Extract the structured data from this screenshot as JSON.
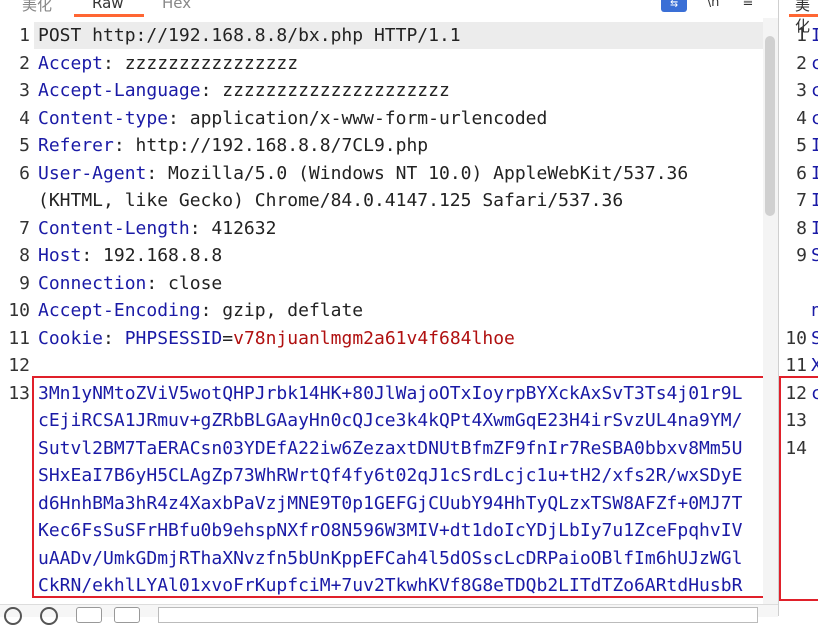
{
  "tabs": [
    {
      "label": "美化",
      "active": false
    },
    {
      "label": "Raw",
      "active": true
    },
    {
      "label": "Hex",
      "active": false
    }
  ],
  "toolbar": {
    "icon1": "\\n",
    "icon2": "≡",
    "wrap_icon": "wrap-icon"
  },
  "right_tab": {
    "label": "美化"
  },
  "request_lines": [
    {
      "num": "1",
      "text": "POST http://192.168.8.8/bx.php HTTP/1.1"
    },
    {
      "num": "2",
      "key": "Accept",
      "val": " zzzzzzzzzzzzzzzz"
    },
    {
      "num": "3",
      "key": "Accept-Language",
      "val": " zzzzzzzzzzzzzzzzzzzzz"
    },
    {
      "num": "4",
      "key": "Content-type",
      "val": " application/x-www-form-urlencoded"
    },
    {
      "num": "5",
      "key": "Referer",
      "val": " http://192.168.8.8/7CL9.php"
    },
    {
      "num": "6",
      "key": "User-Agent",
      "val": " Mozilla/5.0 (Windows NT 10.0) AppleWebKit/537.36"
    },
    {
      "num": "",
      "cont": "(KHTML, like Gecko) Chrome/84.0.4147.125 Safari/537.36"
    },
    {
      "num": "7",
      "key": "Content-Length",
      "val": " 412632"
    },
    {
      "num": "8",
      "key": "Host",
      "val": " 192.168.8.8"
    },
    {
      "num": "9",
      "key": "Connection",
      "val": " close"
    },
    {
      "num": "10",
      "key": "Accept-Encoding",
      "val": " gzip, deflate"
    },
    {
      "num": "11",
      "key": "Cookie",
      "val": " ",
      "cookie_name": "PHPSESSID",
      "cookie_eq": "=",
      "cookie_val": "v78njuanlmgm2a61v4f684lhoe"
    },
    {
      "num": "12",
      "text": ""
    }
  ],
  "body": {
    "num": "13",
    "lines": [
      "3Mn1yNMtoZViV5wotQHPJrbk14HK+80JlWajoOTxIoyrpBYXckAxSvT3Ts4j01r9L",
      "cEjiRCSA1JRmuv+gZRbBLGAayHn0cQJce3k4kQPt4XwmGqE23H4irSvzUL4na9YM/",
      "Sutvl2BM7TaERACsn03YDEfA22iw6ZezaxtDNUtBfmZF9fnIr7ReSBA0bbxv8Mm5U",
      "SHxEaI7B6yH5CLAgZp73WhRWrtQf4fy6t02qJ1cSrdLcjc1u+tH2/xfs2R/wxSDyE",
      "d6HnhBMa3hR4z4XaxbPaVzjMNE9T0p1GEFGjCUubY94HhTyQLzxTSW8AFZf+0MJ7T",
      "Kec6FsSuSFrHBfu0b9ehspNXfrO8N596W3MIV+dt1doIcYDjLbIy7u1ZceFpqhvIV",
      "uAADv/UmkGDmjRThaXNvzfn5bUnKppEFCah4l5dOSscLcDRPaioOBlfIm6hUJzWGl",
      "CkRN/ekhlLYAl01xvoFrKupfciM+7uv2TkwhKVf8G8eTDQb2LITdTZo6ARtdHusbR"
    ]
  },
  "right_pane": {
    "rows": [
      {
        "num": "1",
        "text": "I"
      },
      {
        "num": "2",
        "text": "c"
      },
      {
        "num": "3",
        "text": "c"
      },
      {
        "num": "4",
        "text": "c"
      },
      {
        "num": "5",
        "text": "I"
      },
      {
        "num": "6",
        "text": "I"
      },
      {
        "num": "7",
        "text": "I"
      },
      {
        "num": "8",
        "text": "I"
      },
      {
        "num": "9",
        "text": "S"
      },
      {
        "num": "",
        "text": ""
      },
      {
        "num": "",
        "text": "n"
      },
      {
        "num": "10",
        "text": "S"
      },
      {
        "num": "11",
        "text": "X"
      },
      {
        "num": "12",
        "text": "c"
      },
      {
        "num": "13",
        "text": ""
      },
      {
        "num": "14",
        "text": ""
      }
    ]
  }
}
